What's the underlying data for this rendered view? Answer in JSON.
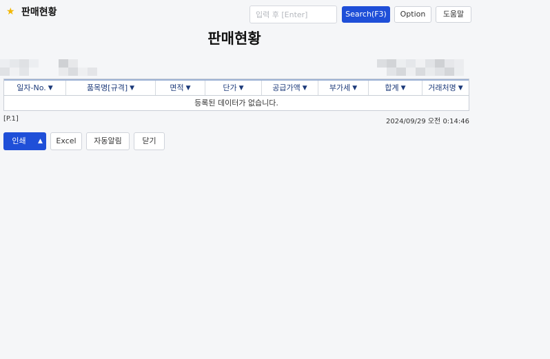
{
  "header": {
    "title": "판매현황",
    "search_placeholder": "입력 후 [Enter]",
    "search_label": "Search(F3)",
    "option_label": "Option",
    "help_label": "도움말",
    "star_color": "#f2b705"
  },
  "report": {
    "title": "판매현황"
  },
  "grid": {
    "columns": [
      "일자-No.",
      "품목명[규격]",
      "면적",
      "단가",
      "공급가액",
      "부가세",
      "합계",
      "거래처명"
    ],
    "empty_message": "등록된 데이터가 없습니다."
  },
  "footer": {
    "page": "[P.1]",
    "timestamp": "2024/09/29 오전 0:14:46"
  },
  "actions": {
    "print_label": "인쇄",
    "excel_label": "Excel",
    "alert_label": "자동알림",
    "close_label": "닫기"
  },
  "colors": {
    "primary": "#1f4fd8",
    "header_text": "#1c3a7a"
  }
}
